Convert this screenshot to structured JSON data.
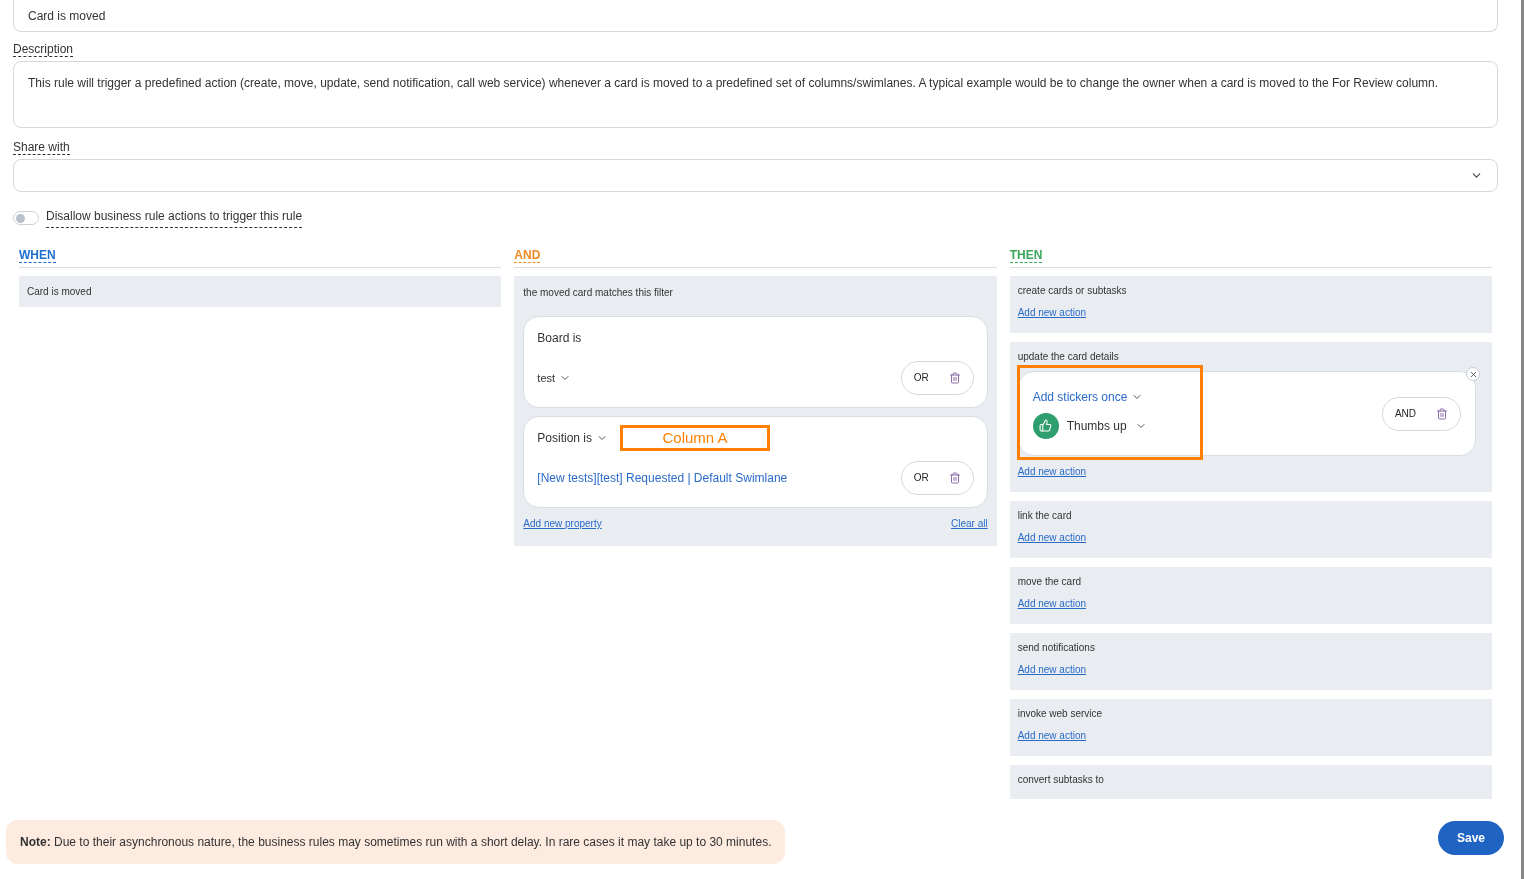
{
  "name_field": {
    "value": "Card is moved"
  },
  "description": {
    "label": "Description",
    "value": "This rule will trigger a predefined action (create, move, update, send notification, call web service) whenever a card is moved to a predefined set of columns/swimlanes. A typical example would be to change the owner when a card is moved to the For Review column."
  },
  "share_with": {
    "label": "Share with"
  },
  "toggle": {
    "label": "Disallow business rule actions to trigger this rule",
    "on": false
  },
  "when": {
    "heading": "WHEN",
    "items": [
      {
        "title": "Card is moved"
      }
    ]
  },
  "and": {
    "heading": "AND",
    "title": "the moved card matches this filter",
    "conditions": [
      {
        "kind": "board",
        "label": "Board is",
        "value": "test",
        "button": "OR"
      },
      {
        "kind": "position",
        "label": "Position is",
        "annotation": "Column A",
        "value": "[New tests][test] Requested | Default Swimlane",
        "button": "OR"
      }
    ],
    "add_link": "Add new property",
    "clear_link": "Clear all"
  },
  "then": {
    "heading": "THEN",
    "groups": [
      {
        "title": "create cards or subtasks",
        "link": "Add new action"
      },
      {
        "title": "update the card details",
        "actions": [
          {
            "type": "Add stickers once",
            "sticker": "Thumbs up",
            "button": "AND",
            "highlighted": true
          }
        ],
        "link": "Add new action"
      },
      {
        "title": "link the card",
        "link": "Add new action"
      },
      {
        "title": "move the card",
        "link": "Add new action"
      },
      {
        "title": "send notifications",
        "link": "Add new action"
      },
      {
        "title": "invoke web service",
        "link": "Add new action"
      },
      {
        "title": "convert subtasks to"
      }
    ]
  },
  "note": "**Note:** Due to their asynchronous nature, the business rules may sometimes run with a short delay. In rare cases it may take up to 30 minutes.",
  "save_button": "Save"
}
